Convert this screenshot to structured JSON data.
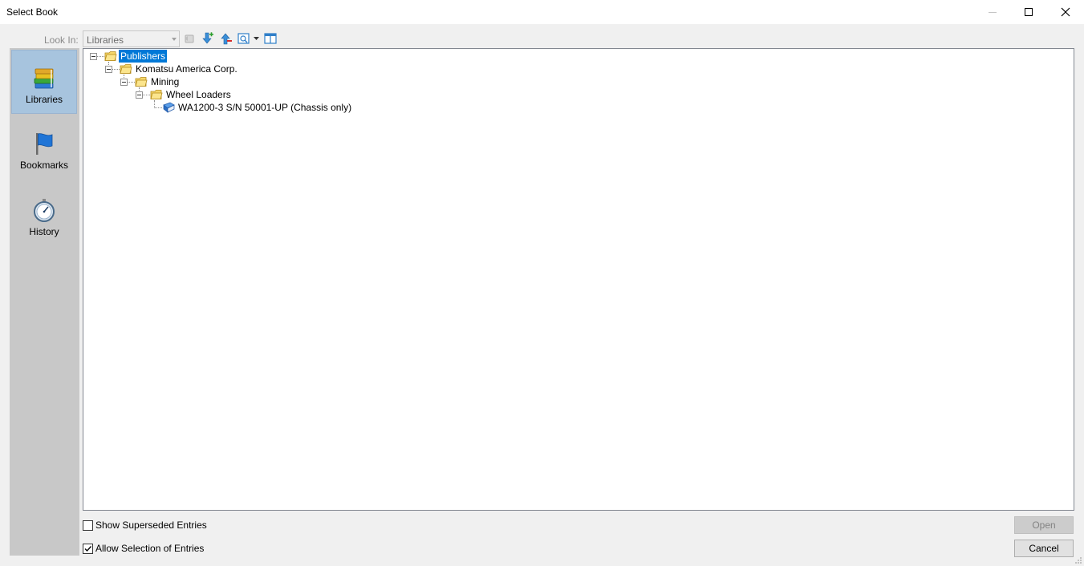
{
  "window": {
    "title": "Select Book"
  },
  "toolbar": {
    "look_in_label": "Look In:",
    "look_in_value": "Libraries"
  },
  "nav": {
    "items": [
      {
        "label": "Libraries",
        "icon": "books-icon",
        "selected": true
      },
      {
        "label": "Bookmarks",
        "icon": "flag-icon",
        "selected": false
      },
      {
        "label": "History",
        "icon": "stopwatch-icon",
        "selected": false
      }
    ]
  },
  "tree": {
    "nodes": [
      {
        "label": "Publishers",
        "icon": "folder-icon",
        "depth": 0,
        "selected": true
      },
      {
        "label": "Komatsu America Corp.",
        "icon": "folder-icon",
        "depth": 1,
        "selected": false
      },
      {
        "label": "Mining",
        "icon": "folder-icon",
        "depth": 2,
        "selected": false
      },
      {
        "label": "Wheel Loaders",
        "icon": "folder-icon",
        "depth": 3,
        "selected": false
      },
      {
        "label": "WA1200-3 S/N 50001-UP (Chassis only)",
        "icon": "book-icon",
        "depth": 4,
        "selected": false
      }
    ]
  },
  "options": {
    "show_superseded": {
      "label": "Show Superseded Entries",
      "checked": false
    },
    "allow_selection": {
      "label": "Allow Selection of Entries",
      "checked": true
    }
  },
  "buttons": {
    "open": "Open",
    "cancel": "Cancel"
  },
  "colors": {
    "selection": "#0078d7",
    "nav_selected": "#a7c4de",
    "nav_background": "#c8c8c8"
  }
}
